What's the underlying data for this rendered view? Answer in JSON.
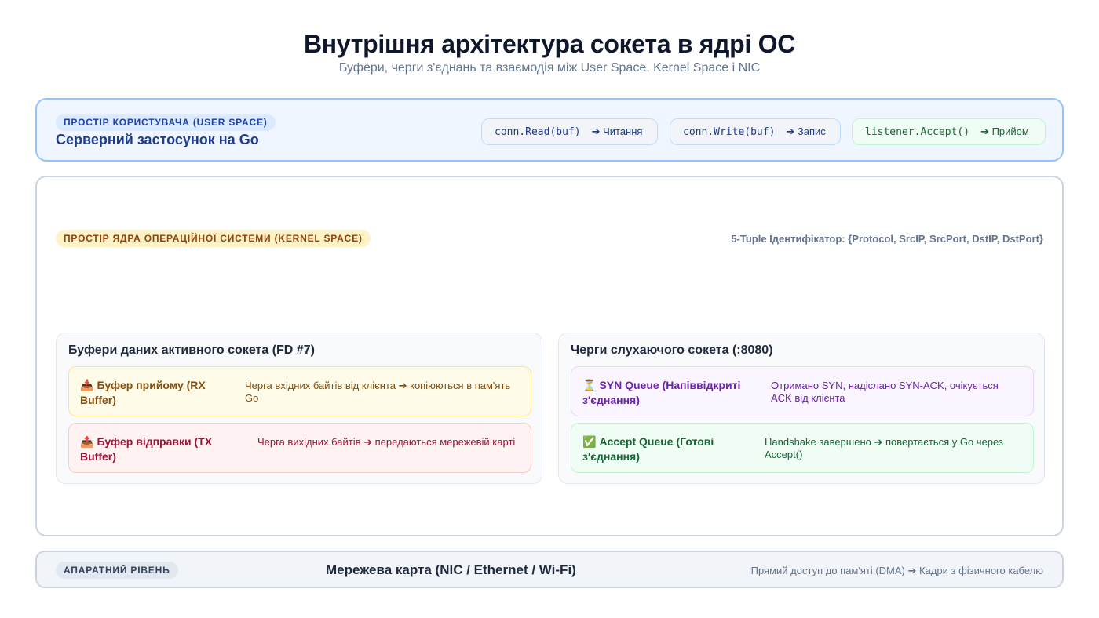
{
  "header": {
    "title": "Внутрішня архітектура сокета в ядрі ОС",
    "subtitle": "Буфери, черги з'єднань та взаємодія між User Space, Kernel Space і NIC"
  },
  "user_space": {
    "badge": "ПРОСТІР КОРИСТУВАЧА (USER SPACE)",
    "app_title": "Серверний застосунок на Go",
    "ops": [
      {
        "code": "conn.Read(buf)",
        "label": "➔ Читання"
      },
      {
        "code": "conn.Write(buf)",
        "label": "➔ Запис"
      },
      {
        "code": "listener.Accept()",
        "label": "➔ Прийом"
      }
    ]
  },
  "kernel_space": {
    "badge": "ПРОСТІР ЯДРА ОПЕРАЦІЙНОЇ СИСТЕМИ (KERNEL SPACE)",
    "tuple": "5-Tuple Ідентифікатор: {Protocol, SrcIP, SrcPort, DstIP, DstPort}",
    "active_socket": {
      "title": "Буфери даних активного сокета (FD #7)",
      "rx": {
        "icon": "📥",
        "name": "Буфер прийому (RX Buffer)",
        "desc": "Черга вхідних байтів від клієнта ➔ копіюються в пам'ять Go"
      },
      "tx": {
        "icon": "📤",
        "name": "Буфер відправки (TX Buffer)",
        "desc": "Черга вихідних байтів ➔ передаються мережевій карті"
      }
    },
    "listening_socket": {
      "title": "Черги слухаючого сокета (:8080)",
      "syn": {
        "icon": "⏳",
        "name": "SYN Queue (Напіввідкриті з'єднання)",
        "desc": "Отримано SYN, надіслано SYN-ACK, очікується ACK від клієнта"
      },
      "accept": {
        "icon": "✅",
        "name": "Accept Queue (Готові з'єднання)",
        "desc": "Handshake завершено ➔ повертається у Go через Accept()"
      }
    }
  },
  "hardware": {
    "badge": "АПАРАТНИЙ РІВЕНЬ",
    "title": "Мережева карта (NIC / Ethernet / Wi-Fi)",
    "note": "Прямий доступ до пам'яті (DMA) ➔ Кадри з фізичного кабелю"
  }
}
